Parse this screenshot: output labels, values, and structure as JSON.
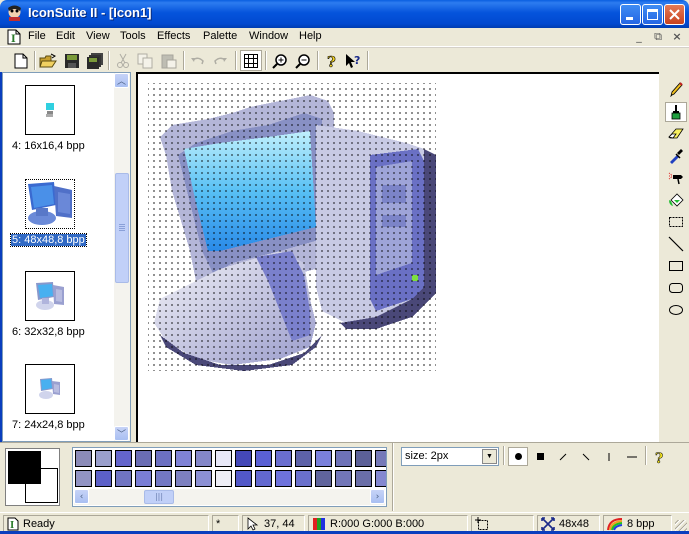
{
  "window": {
    "title": "IconSuite II - [Icon1]",
    "app_icon": "iconsuite-app-icon",
    "controls": [
      "minimize",
      "maximize",
      "close"
    ]
  },
  "menubar": {
    "items": [
      {
        "label": "File"
      },
      {
        "label": "Edit"
      },
      {
        "label": "View"
      },
      {
        "label": "Tools"
      },
      {
        "label": "Effects"
      },
      {
        "label": "Palette"
      },
      {
        "label": "Window"
      },
      {
        "label": "Help"
      }
    ],
    "mdi_controls": {
      "minimize": "_",
      "restore": "⧉",
      "close": "×"
    }
  },
  "toolbar": {
    "buttons": [
      {
        "name": "new",
        "icon": "new-document-icon",
        "enabled": true
      },
      {
        "name": "open",
        "icon": "open-folder-icon",
        "enabled": true
      },
      {
        "name": "save",
        "icon": "save-disk-icon",
        "enabled": true
      },
      {
        "name": "save-all",
        "icon": "save-all-icon",
        "enabled": true
      },
      {
        "name": "cut",
        "icon": "scissors-icon",
        "enabled": false
      },
      {
        "name": "copy",
        "icon": "copy-icon",
        "enabled": false
      },
      {
        "name": "paste",
        "icon": "paste-icon",
        "enabled": false
      },
      {
        "name": "undo",
        "icon": "undo-icon",
        "enabled": false
      },
      {
        "name": "redo",
        "icon": "redo-icon",
        "enabled": false
      },
      {
        "name": "grid",
        "icon": "grid-icon",
        "enabled": true,
        "pressed": true
      },
      {
        "name": "zoom-in",
        "icon": "zoom-in-icon",
        "enabled": true
      },
      {
        "name": "zoom-out",
        "icon": "zoom-out-icon",
        "enabled": true
      },
      {
        "name": "help",
        "icon": "help-icon",
        "enabled": true
      },
      {
        "name": "context-help",
        "icon": "context-help-icon",
        "enabled": true
      }
    ]
  },
  "images_list": {
    "items": [
      {
        "label": "4: 16x16,4 bpp",
        "selected": false
      },
      {
        "label": "5: 48x48,8 bpp",
        "selected": true
      },
      {
        "label": "6: 32x32,8 bpp",
        "selected": false
      },
      {
        "label": "7: 24x24,8 bpp",
        "selected": false
      }
    ]
  },
  "canvas": {
    "image_size": "48x48",
    "show_grid": true,
    "subject": "computer-monitor-icon"
  },
  "tools": [
    {
      "name": "pencil",
      "icon": "pencil-icon",
      "selected": false
    },
    {
      "name": "brush",
      "icon": "brush-icon",
      "selected": true
    },
    {
      "name": "eraser",
      "icon": "eraser-icon",
      "selected": false
    },
    {
      "name": "color-picker",
      "icon": "eyedropper-icon",
      "selected": false
    },
    {
      "name": "airbrush",
      "icon": "airbrush-icon",
      "selected": false
    },
    {
      "name": "fill",
      "icon": "paint-bucket-icon",
      "selected": false
    },
    {
      "name": "select",
      "icon": "selection-rect-icon",
      "selected": false
    },
    {
      "name": "line",
      "icon": "line-icon",
      "selected": false
    },
    {
      "name": "rectangle",
      "icon": "rectangle-icon",
      "selected": false
    },
    {
      "name": "rounded-rectangle",
      "icon": "rounded-rect-icon",
      "selected": false
    },
    {
      "name": "ellipse",
      "icon": "ellipse-icon",
      "selected": false
    }
  ],
  "colors": {
    "foreground": "#000000",
    "background": "#ffffff",
    "palette_row1": [
      "#8b8bb8",
      "#9a9fcc",
      "#6465cc",
      "#6a6db4",
      "#6c70c2",
      "#7f82d6",
      "#8487c9",
      "#e8e8f8",
      "#4448b8",
      "#5a60d4",
      "#6a6ed0",
      "#5d62a8",
      "#7a80dc",
      "#6e72b8",
      "#5c6098",
      "#7579b8"
    ],
    "palette_row2": [
      "#9294c4",
      "#5c60c8",
      "#7074c2",
      "#7a7ed6",
      "#7378c4",
      "#7d80c0",
      "#8c90d4",
      "#eeeef6",
      "#5258c8",
      "#6268d0",
      "#6e72dc",
      "#6a70cc",
      "#60649c",
      "#7276b8",
      "#6a6ea8",
      "#8488d0"
    ]
  },
  "brush_options": {
    "size_label": "size: 2px",
    "shapes": [
      {
        "name": "round",
        "icon": "round-brush-icon",
        "selected": true
      },
      {
        "name": "square",
        "icon": "square-brush-icon",
        "selected": false
      },
      {
        "name": "slash",
        "icon": "forward-slash-brush-icon",
        "selected": false
      },
      {
        "name": "backslash",
        "icon": "backslash-brush-icon",
        "selected": false
      },
      {
        "name": "vertical",
        "icon": "vertical-brush-icon",
        "selected": false
      },
      {
        "name": "horizontal",
        "icon": "horizontal-brush-icon",
        "selected": false
      }
    ],
    "help_icon": "help-icon"
  },
  "statusbar": {
    "status": "Ready",
    "modified": "*",
    "cursor_pos": "37, 44",
    "color_value": "R:000 G:000 B:000",
    "selection": "",
    "image_size": "48x48",
    "bit_depth": "8 bpp"
  }
}
